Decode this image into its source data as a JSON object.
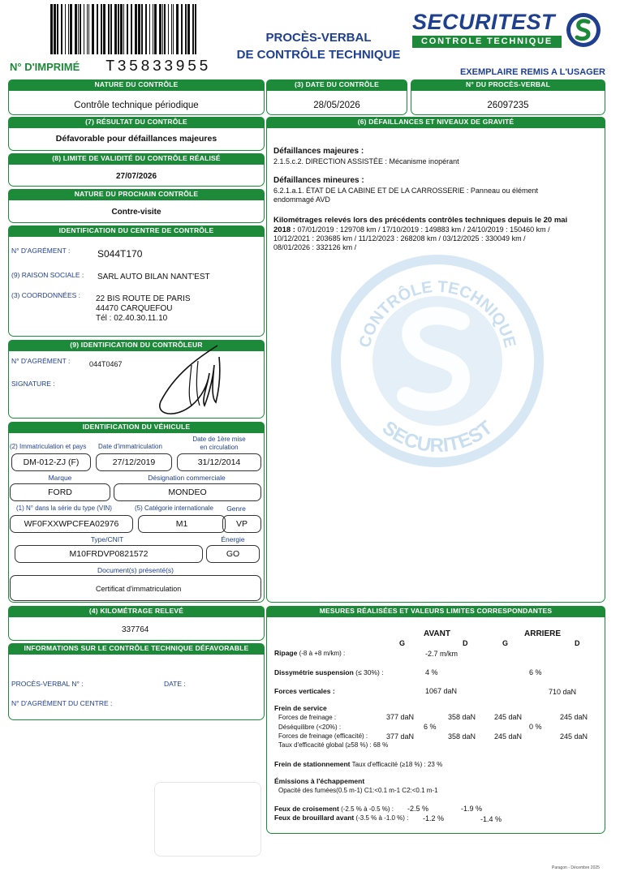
{
  "header": {
    "printed_no_label": "N° D'IMPRIMÉ",
    "printed_no": "T35833955",
    "title_line1": "PROCÈS-VERBAL",
    "title_line2": "DE CONTRÔLE TECHNIQUE",
    "brand_name": "SECURITEST",
    "brand_sub": "CONTROLE TECHNIQUE",
    "copy_label": "EXEMPLAIRE REMIS A L'USAGER",
    "colors": {
      "green": "#1d8a3a",
      "blue": "#1f3f8f"
    }
  },
  "control": {
    "nature_header": "NATURE DU CONTRÔLE",
    "nature": "Contrôle technique périodique",
    "date_header": "(3) DATE DU CONTRÔLE",
    "date": "28/05/2026",
    "pv_header": "N° DU PROCÈS-VERBAL",
    "pv_number": "26097235"
  },
  "result": {
    "header": "(7) RÉSULTAT DU CONTRÔLE",
    "value": "Défavorable pour défaillances majeures",
    "validity_header": "(8) LIMITE DE VALIDITÉ DU CONTRÔLE RÉALISÉ",
    "validity": "27/07/2026",
    "next_header": "NATURE DU PROCHAIN CONTRÔLE",
    "next": "Contre-visite"
  },
  "centre": {
    "header": "IDENTIFICATION DU CENTRE DE CONTRÔLE",
    "agrement_label": "N° D'AGRÉMENT :",
    "agrement": "S044T170",
    "raison_label": "(9) RAISON SOCIALE :",
    "raison": "SARL AUTO BILAN NANT'EST",
    "coord_label": "(3) COORDONNÉES :",
    "address1": "22 BIS ROUTE DE PARIS",
    "address2": "44470 CARQUEFOU",
    "phone": "Tél : 02.40.30.11.10"
  },
  "controleur": {
    "header": "(9) IDENTIFICATION DU CONTRÔLEUR",
    "agrement_label": "N° D'AGRÉMENT :",
    "agrement": "044T0467",
    "signature_label": "SIGNATURE :"
  },
  "vehicle": {
    "header": "IDENTIFICATION DU VÉHICULE",
    "immat_label": "(2) Immatriculation et pays",
    "immat": "DM-012-ZJ  (F)",
    "date_immat_label": "Date d'immatriculation",
    "date_immat": "27/12/2019",
    "first_circ_label1": "Date de 1ère mise",
    "first_circ_label2": "en circulation",
    "first_circ": "31/12/2014",
    "marque_label": "Marque",
    "marque": "FORD",
    "designation_label": "Désignation commerciale",
    "designation": "MONDEO",
    "vin_label": "(1) N° dans la série du type (VIN)",
    "vin": "WF0FXXWPCFEA02976",
    "categorie_label": "(5) Catégorie internationale",
    "categorie": "M1",
    "genre_label": "Genre",
    "genre": "VP",
    "type_label": "Type/CNIT",
    "type": "M10FRDVP0821572",
    "energie_label": "Énergie",
    "energie": "GO",
    "docs_label": "Document(s) présenté(s)",
    "docs": "Certificat d'immatriculation"
  },
  "mileage": {
    "header": "(4) KILOMÉTRAGE RELEVÉ",
    "value": "337764"
  },
  "unfavourable": {
    "header": "INFORMATIONS SUR LE CONTRÔLE TECHNIQUE DÉFAVORABLE",
    "pv_label": "PROCÈS-VERBAL N° :",
    "date_label": "DATE :",
    "agrement_label": "N° D'AGRÉMENT DU CENTRE :"
  },
  "defects": {
    "header": "(6) DÉFAILLANCES ET NIVEAUX DE GRAVITÉ",
    "major_title": "Défaillances majeures :",
    "major_1": "2.1.5.c.2. DIRECTION ASSISTÉE : Mécanisme inopérant",
    "minor_title": "Défaillances mineures :",
    "minor_1a": "6.2.1.a.1. ÉTAT DE LA CABINE ET DE LA CARROSSERIE : Panneau ou élément",
    "minor_1b": "endommagé AVD",
    "km_title": "Kilométrages relevés lors des précédents contrôles techniques depuis le 20 mai",
    "km_line1_bold": "2018 :",
    "km_line1": " 07/01/2019 : 129708 km / 17/10/2019 : 149883 km / 24/10/2019 : 150460 km /",
    "km_line2": "10/12/2021 : 203685 km / 11/12/2023 : 268208 km / 03/12/2025 : 330049 km /",
    "km_line3": "08/01/2026 : 332126 km /",
    "watermark_top": "CONTRÔLE TECHNIQUE",
    "watermark_bottom": "SECURITEST"
  },
  "measures": {
    "header": "MESURES RÉALISÉES ET VALEURS LIMITES CORRESPONDANTES",
    "avant": "AVANT",
    "arriere": "ARRIERE",
    "g": "G",
    "d": "D",
    "ripage_label": "Ripage",
    "ripage_limit": " (-8 à +8 m/km) :",
    "ripage": "-2.7 m/km",
    "dissym_label": "Dissymétrie suspension",
    "dissym_limit": " (≤ 30%) :",
    "dissym_av": "4 %",
    "dissym_ar": "6 %",
    "forces_v_label": "Forces verticales :",
    "forces_v_av": "1067 daN",
    "forces_v_ar": "710 daN",
    "frein_service": "Frein de service",
    "forces_freinage_label": "Forces de freinage :",
    "ff_av_g": "377 daN",
    "ff_av_d": "358 daN",
    "ff_ar_g": "245 daN",
    "ff_ar_d": "245 daN",
    "desequilibre_label": "Déséquilibre (<20%) :",
    "deseq_av": "6 %",
    "deseq_ar": "0 %",
    "ff_eff_label": "Forces de freinage (efficacité) :",
    "ffe_av_g": "377 daN",
    "ffe_av_d": "358 daN",
    "ffe_ar_g": "245 daN",
    "ffe_ar_d": "245 daN",
    "taux_global": "Taux d'efficacité global (≥58 %) : 68 %",
    "frein_stat_label": "Frein de stationnement",
    "frein_stat": " Taux d'efficacité (≥18 %) : 23 %",
    "emissions_label": "Émissions à l'échappement",
    "emissions": "Opacité des fumées(0.5 m-1) C1:<0.1 m-1  C2:<0.1 m-1",
    "croisement_label": "Feux de croisement",
    "croisement_limit": " (-2.5 % à  -0.5 %) :",
    "croisement_g": "-2.5 %",
    "croisement_d": "-1.9 %",
    "brouillard_label": "Feux de brouillard avant",
    "brouillard_limit": " (-3.5 % à -1.0 %) :",
    "brouillard_g": "-1.2 %",
    "brouillard_d": "-1.4 %"
  },
  "footer": {
    "printer": "Paragon - Décembre 2025"
  }
}
